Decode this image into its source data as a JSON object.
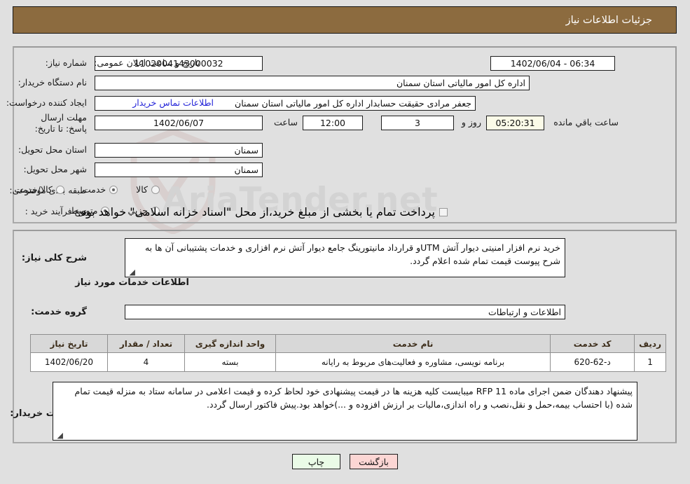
{
  "header": {
    "title": "جزئیات اطلاعات نیاز"
  },
  "watermark": {
    "text": "AriaTender.net"
  },
  "main_info": {
    "need_number": {
      "label": "شماره نیاز:",
      "value": "1102004143000032"
    },
    "public_announce": {
      "label": "تاریخ و ساعت اعلان عمومی:",
      "value": "06:34 - 1402/06/04"
    },
    "buyer_org": {
      "label": "نام دستگاه خریدار:",
      "value": "اداره کل امور مالیاتی استان سمنان"
    },
    "request_creator": {
      "label": "ایجاد کننده درخواست:",
      "value": "جعفر مرادی حقیقت حسابدار اداره کل امور مالیاتی استان سمنان"
    },
    "buyer_contact_link": "اطلاعات تماس خریدار",
    "deadline": {
      "label": "مهلت ارسال پاسخ: تا تاریخ:",
      "date": "1402/06/07",
      "time_label": "ساعت",
      "time": "12:00",
      "days": "3",
      "days_label": "روز و",
      "countdown": "05:20:31",
      "countdown_label": "ساعت باقي مانده"
    },
    "delivery_province": {
      "label": "استان محل تحویل:",
      "value": "سمنان"
    },
    "delivery_city": {
      "label": "شهر محل تحویل:",
      "value": "سمنان"
    },
    "subject_class": {
      "label": "طبقه بندی موضوعی:",
      "options": [
        {
          "text": "کالا",
          "selected": false
        },
        {
          "text": "خدمت",
          "selected": true
        },
        {
          "text": "کالا/خدمت",
          "selected": false
        }
      ]
    },
    "purchase_process": {
      "label": "نوع فرآیند خرید :",
      "options": [
        {
          "text": "جزیي",
          "selected": false
        },
        {
          "text": "متوسط",
          "selected": true
        }
      ],
      "checkbox_text": "پرداخت تمام یا بخشی از مبلغ خرید،از محل \"اسناد خزانه اسلامی\" خواهد بود.",
      "checkbox_checked": false
    }
  },
  "description": {
    "label": "شرح کلی نیاز:",
    "value": "خرید نرم افزار امنیتی دیوار آتش UTMو قرارداد مانیتورینگ جامع دیوار آتش نرم افزاری و خدمات پشتیبانی آن ها به شرح پیوست قیمت تمام شده اعلام گردد."
  },
  "services_section": {
    "heading": "اطلاعات خدمات مورد نیاز",
    "group_label": "گروه خدمت:",
    "group_value": "اطلاعات و ارتباطات"
  },
  "table": {
    "columns": [
      "ردیف",
      "کد خدمت",
      "نام خدمت",
      "واحد اندازه گیری",
      "تعداد / مقدار",
      "تاریخ نیاز"
    ],
    "rows": [
      {
        "index": "1",
        "code": "د-62-620",
        "name": "برنامه نویسی، مشاوره و فعالیت‌های مربوط به رایانه",
        "unit": "بسته",
        "quantity": "4",
        "need_date": "1402/06/20"
      }
    ]
  },
  "buyer_notes": {
    "label": "توضیحات خریدار:",
    "value": "پیشنهاد دهندگان ضمن اجرای ماده 11 RFP میبایست کلیه هزینه ها در قیمت پیشنهادی خود لحاظ کرده و قیمت اعلامی در سامانه ستاد به منزله قیمت تمام شده (با احتساب بیمه،حمل و نقل،نصب و راه اندازی،مالیات بر ارزش افزوده و ...)خواهد بود.پیش فاکتور ارسال گردد."
  },
  "buttons": {
    "back": "بازگشت",
    "print": "چاپ"
  }
}
